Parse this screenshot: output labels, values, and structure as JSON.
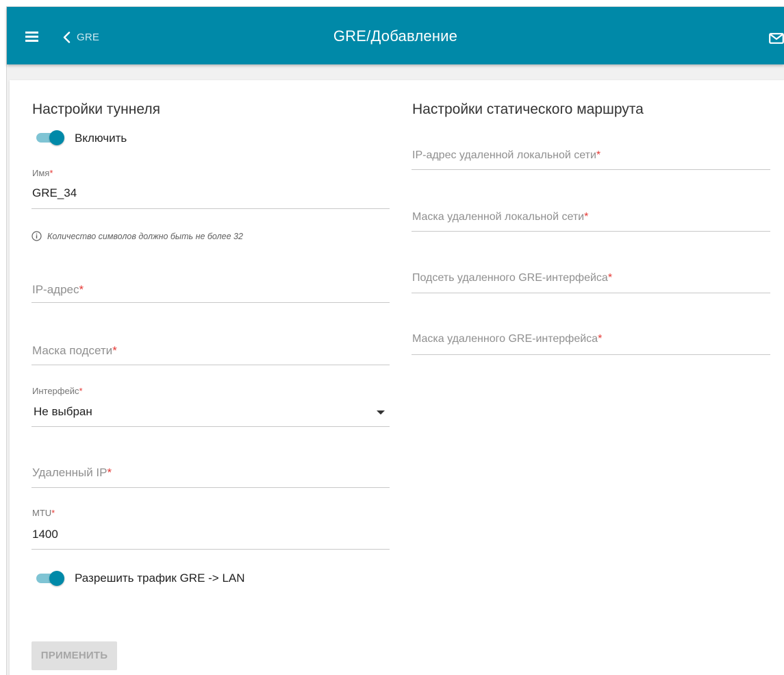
{
  "header": {
    "back_label": "GRE",
    "title": "GRE/Добавление"
  },
  "tunnel": {
    "section_title": "Настройки туннеля",
    "enable_label": "Включить",
    "enabled": true,
    "name": {
      "label": "Имя",
      "value": "GRE_34",
      "hint": "Количество символов должно быть не более 32"
    },
    "ip_address": {
      "placeholder": "IP-адрес"
    },
    "subnet_mask": {
      "placeholder": "Маска подсети"
    },
    "interface": {
      "label": "Интерфейс",
      "value": "Не выбран"
    },
    "remote_ip": {
      "placeholder": "Удаленный IP"
    },
    "mtu": {
      "label": "MTU",
      "value": "1400"
    },
    "allow_traffic_label": "Разрешить трафик GRE -> LAN",
    "allow_traffic": true
  },
  "static_route": {
    "section_title": "Настройки статического маршрута",
    "remote_lan_ip": {
      "placeholder": "IP-адрес удаленной локальной сети"
    },
    "remote_lan_mask": {
      "placeholder": "Маска удаленной локальной сети"
    },
    "remote_gre_subnet": {
      "placeholder": "Подсеть удаленного GRE-интерфейса"
    },
    "remote_gre_mask": {
      "placeholder": "Маска удаленного GRE-интерфейса"
    }
  },
  "required_mark": "*",
  "apply_button_label": "ПРИМЕНИТЬ",
  "colors": {
    "header_bg": "#0089a8",
    "accent": "#0089a8",
    "required": "#e53935",
    "button_disabled_bg": "#e0e0e0",
    "button_disabled_text": "#a6a6a6"
  },
  "icons": {
    "menu": "hamburger-menu-icon",
    "back": "chevron-left-icon",
    "mail": "envelope-icon",
    "info": "info-circle-icon",
    "dropdown": "caret-down-icon"
  }
}
